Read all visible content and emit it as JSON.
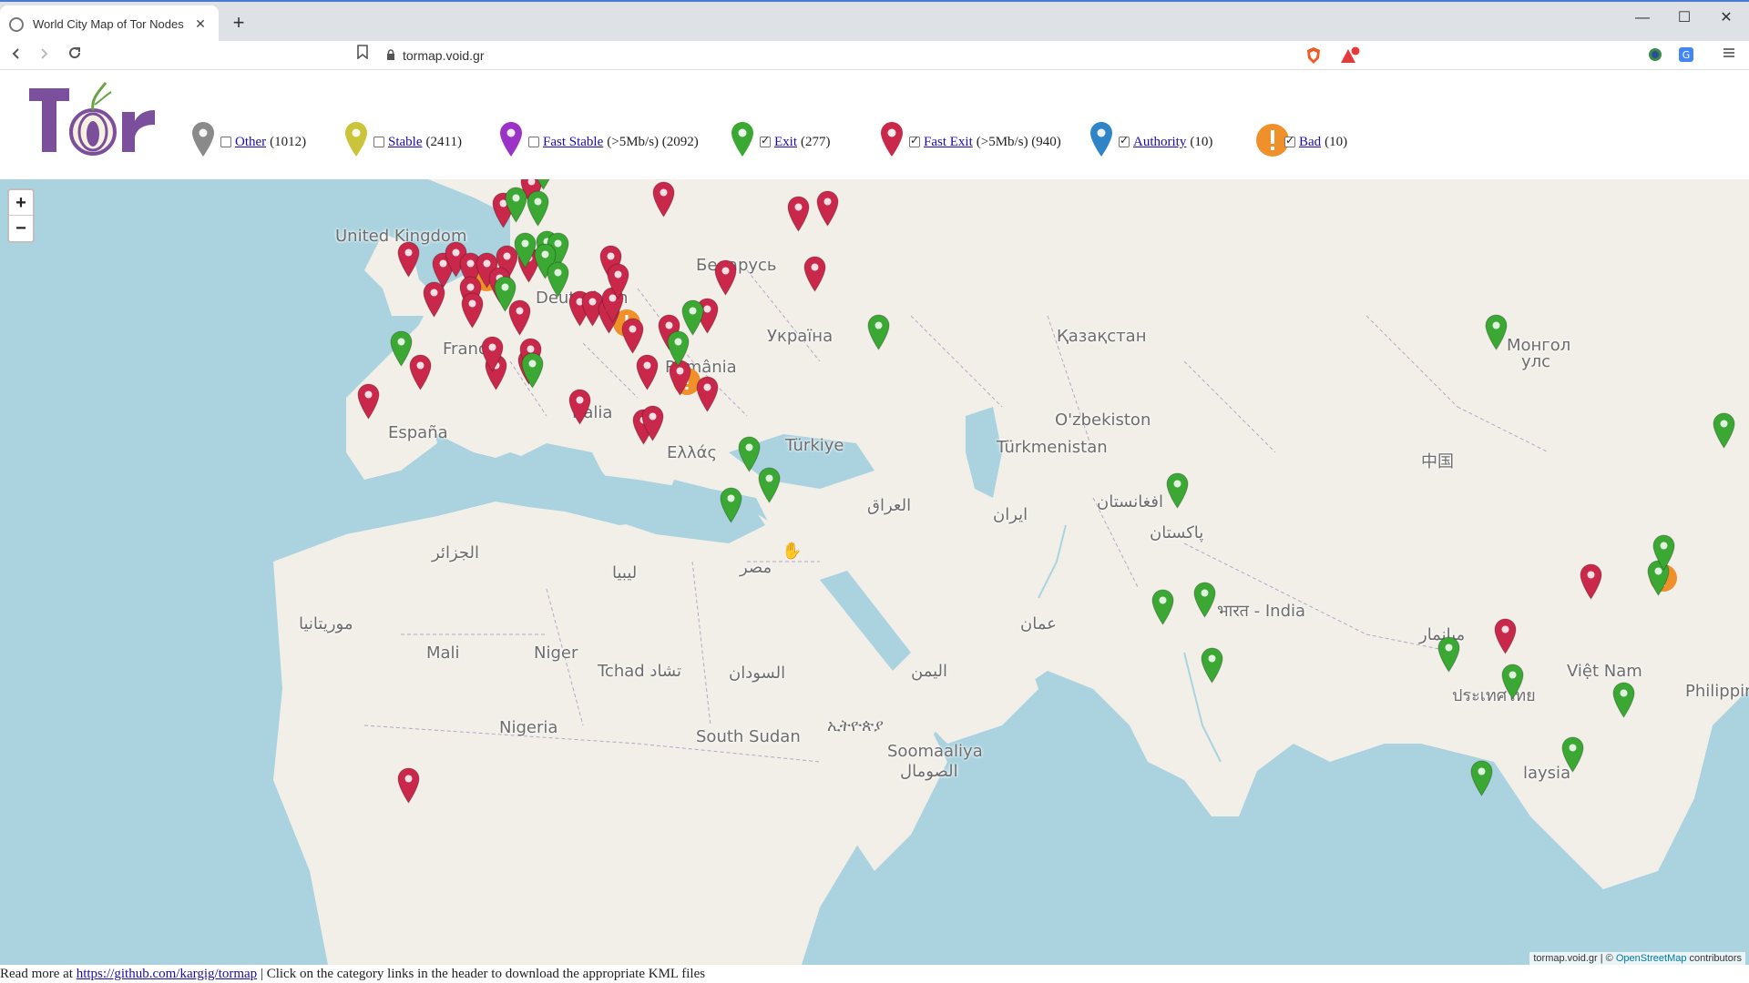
{
  "browser": {
    "tab_title": "World City Map of Tor Nodes",
    "url": "tormap.void.gr",
    "new_tab": "+",
    "close": "✕",
    "minimize": "—",
    "maximize": "☐",
    "window_close": "✕"
  },
  "legend": [
    {
      "label": "Other",
      "count": "(1012)",
      "checked": false,
      "color": "#8a8a8a",
      "icon": "marker-icon"
    },
    {
      "label": "Stable",
      "count": "(2411)",
      "checked": false,
      "color": "#c9c43a",
      "icon": "marker-icon"
    },
    {
      "label": "Fast Stable",
      "count": "(>5Mb/s) (2092)",
      "checked": false,
      "color": "#9b33c7",
      "icon": "marker-icon"
    },
    {
      "label": "Exit",
      "count": "(277)",
      "checked": true,
      "color": "#3aa832",
      "icon": "marker-icon"
    },
    {
      "label": "Fast Exit",
      "count": "(>5Mb/s) (940)",
      "checked": true,
      "color": "#c9284a",
      "icon": "marker-icon"
    },
    {
      "label": "Authority",
      "count": "(10)",
      "checked": true,
      "color": "#2f84c8",
      "icon": "marker-icon"
    },
    {
      "label": "Bad",
      "count": "(10)",
      "checked": true,
      "color": "#f0902a",
      "icon": "warning-icon"
    }
  ],
  "map": {
    "zoom_in": "+",
    "zoom_out": "−",
    "places": [
      "United Kingdom",
      "France",
      "España",
      "Italia",
      "Беларусь",
      "Україна",
      "România",
      "Ελλάς",
      "Türkiye",
      "Қазақстан",
      "O'zbekiston",
      "Türkmenistan",
      "Монгол",
      "улс",
      "中国",
      "العراق",
      "ایران",
      "افغانستان",
      "پاکستان",
      "भारत - India",
      "عمان",
      "اليمن",
      "الجزائر",
      "ليبيا",
      "مصر",
      "موريتانيا",
      "Mali",
      "Niger",
      "Tchad تشاد",
      "السودان",
      "Nigeria",
      "South Sudan",
      "ኢትዮጵያ",
      "Soomaaliya",
      "الصومال",
      "Việt Nam",
      "Philippin",
      "laysia",
      "Deutschlan",
      "ميانمار",
      "ประเทศไทย"
    ],
    "attribution_prefix": "tormap.void.gr | © ",
    "attribution_link": "OpenStreetMap",
    "attribution_suffix": " contributors"
  },
  "footer": {
    "prefix": "Read more at ",
    "link": "https://github.com/kargig/tormap",
    "suffix": " | Click on the category links in the header to download the appropriate KML files"
  }
}
